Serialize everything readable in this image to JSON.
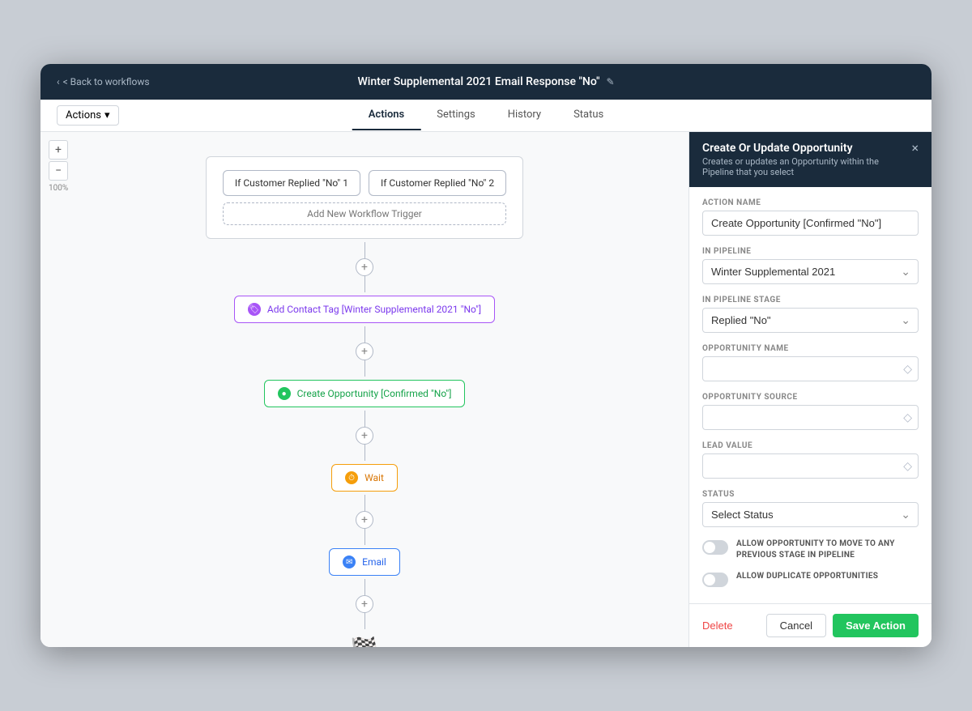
{
  "topBar": {
    "backLabel": "< Back to workflows",
    "workflowTitle": "Winter Supplemental 2021 Email Response \"No\"",
    "editIconLabel": "✎"
  },
  "tabs": {
    "actionsLabel": "Actions",
    "actionsDropdown": "Actions",
    "dropdownIcon": "▾",
    "items": [
      {
        "id": "actions",
        "label": "Actions",
        "active": true
      },
      {
        "id": "settings",
        "label": "Settings",
        "active": false
      },
      {
        "id": "history",
        "label": "History",
        "active": false
      },
      {
        "id": "status",
        "label": "Status",
        "active": false
      }
    ]
  },
  "canvas": {
    "zoomPlus": "+",
    "zoomMinus": "−",
    "zoomLevel": "100%",
    "triggerNodes": [
      {
        "id": "trigger1",
        "label": "If Customer Replied \"No\" 1"
      },
      {
        "id": "trigger2",
        "label": "If Customer Replied \"No\" 2"
      }
    ],
    "addTriggerLabel": "Add New Workflow Trigger",
    "nodes": [
      {
        "id": "tag",
        "type": "tag",
        "label": "Add Contact Tag [Winter Supplemental 2021 \"No\"]",
        "iconType": "purple",
        "iconSymbol": "🏷"
      },
      {
        "id": "opportunity",
        "type": "opportunity",
        "label": "Create Opportunity [Confirmed \"No\"]",
        "iconType": "green",
        "iconSymbol": "●"
      },
      {
        "id": "wait",
        "type": "wait",
        "label": "Wait",
        "iconType": "orange",
        "iconSymbol": "⏱"
      },
      {
        "id": "email",
        "type": "email",
        "label": "Email",
        "iconType": "blue",
        "iconSymbol": "✉"
      }
    ],
    "finishFlag": "🏁"
  },
  "rightPanel": {
    "title": "Create Or Update Opportunity",
    "subtitle": "Creates or updates an Opportunity within the Pipeline that you select",
    "closeIcon": "×",
    "fields": {
      "actionName": {
        "label": "ACTION NAME",
        "value": "Create Opportunity [Confirmed \"No\"]"
      },
      "inPipeline": {
        "label": "IN PIPELINE",
        "value": "Winter Supplemental 2021",
        "options": [
          "Winter Supplemental 2021"
        ]
      },
      "inPipelineStage": {
        "label": "IN PIPELINE STAGE",
        "value": "Replied \"No\"",
        "options": [
          "Replied \"No\""
        ]
      },
      "opportunityName": {
        "label": "OPPORTUNITY NAME",
        "value": "",
        "placeholder": ""
      },
      "opportunitySource": {
        "label": "OPPORTUNITY SOURCE",
        "value": "",
        "placeholder": ""
      },
      "leadValue": {
        "label": "LEAD VALUE",
        "value": "",
        "placeholder": ""
      },
      "status": {
        "label": "STATUS",
        "value": "Select Status",
        "options": [
          "Select Status"
        ]
      }
    },
    "toggles": [
      {
        "id": "allowPrevious",
        "label": "ALLOW OPPORTUNITY TO MOVE TO ANY PREVIOUS STAGE IN PIPELINE",
        "enabled": false
      },
      {
        "id": "allowDuplicate",
        "label": "ALLOW DUPLICATE OPPORTUNITIES",
        "enabled": false
      }
    ],
    "footer": {
      "deleteLabel": "Delete",
      "cancelLabel": "Cancel",
      "saveLabel": "Save Action"
    }
  }
}
